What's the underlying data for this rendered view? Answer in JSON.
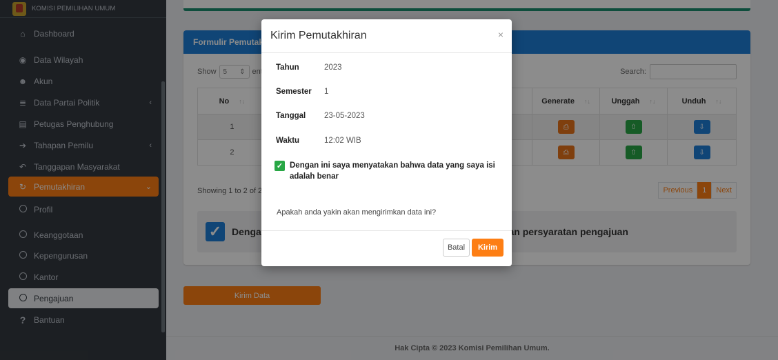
{
  "colors": {
    "sidebar_bg": "#343a40",
    "accent_orange": "#fd7e14",
    "card_header_blue": "#1e7fd8",
    "success_green": "#28a745"
  },
  "sidebar": {
    "brand": "KOMISI PEMILIHAN UMUM",
    "items": [
      {
        "label": "Dashboard",
        "icon": "home-icon"
      },
      {
        "label": "Data Wilayah",
        "icon": "globe-icon"
      },
      {
        "label": "Akun",
        "icon": "users-icon"
      },
      {
        "label": "Data Partai Politik",
        "icon": "database-icon"
      },
      {
        "label": "Petugas Penghubung",
        "icon": "id-card-icon"
      },
      {
        "label": "Tahapan Pemilu",
        "icon": "sign-in-icon"
      },
      {
        "label": "Tanggapan Masyarakat",
        "icon": "reply-icon"
      },
      {
        "label": "Pemutakhiran",
        "icon": "refresh-icon"
      },
      {
        "label": "Profil",
        "icon": "circle-icon"
      },
      {
        "label": "Keanggotaan",
        "icon": "circle-icon"
      },
      {
        "label": "Kepengurusan",
        "icon": "circle-icon"
      },
      {
        "label": "Kantor",
        "icon": "circle-icon"
      },
      {
        "label": "Pengajuan",
        "icon": "circle-icon"
      },
      {
        "label": "Bantuan",
        "icon": "question-icon"
      }
    ]
  },
  "card": {
    "title": "Formulir Pemutakhiran",
    "show_label": "Show",
    "show_value": "5",
    "entries_label": "entries",
    "search_label": "Search:",
    "columns": [
      "No",
      "Generate",
      "Unggah",
      "Unduh"
    ],
    "rows": [
      {
        "no": "1"
      },
      {
        "no": "2"
      }
    ],
    "showing": "Showing 1 to 2 of 2 entries",
    "pager": {
      "prev": "Previous",
      "page": "1",
      "next": "Next"
    },
    "confirm_text": "Dengan ini saya menyatakan bahwa data sudah sesuai dengan persyaratan pengajuan"
  },
  "kirim_data_label": "Kirim Data",
  "footer": "Hak Cipta © 2023 Komisi Pemilihan Umum.",
  "modal": {
    "title": "Kirim Pemutakhiran",
    "close": "×",
    "fields": [
      {
        "label": "Tahun",
        "value": "2023"
      },
      {
        "label": "Semester",
        "value": "1"
      },
      {
        "label": "Tanggal",
        "value": "23-05-2023"
      },
      {
        "label": "Waktu",
        "value": "12:02 WIB"
      }
    ],
    "checkbox_label": "Dengan ini saya menyatakan bahwa data yang saya isi adalah benar",
    "question": "Apakah anda yakin akan mengirimkan data ini?",
    "cancel": "Batal",
    "submit": "Kirim"
  }
}
